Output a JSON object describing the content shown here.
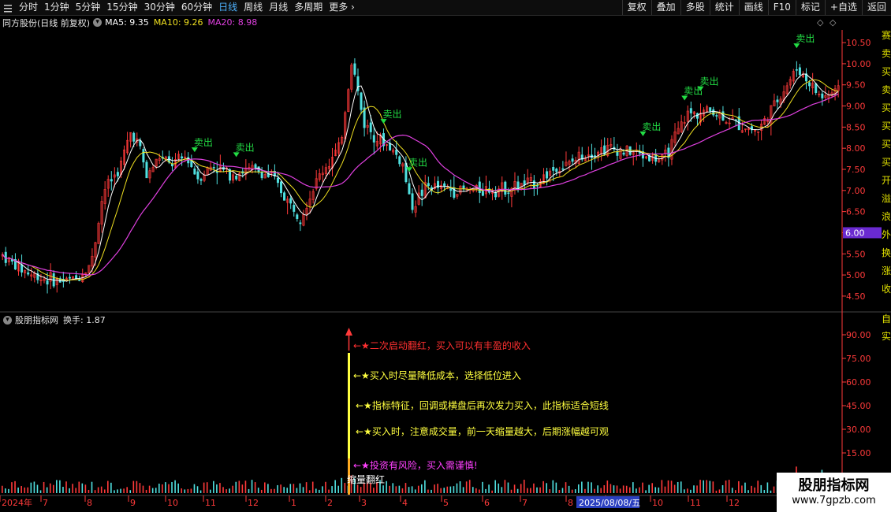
{
  "toolbar": {
    "periods": [
      "分时",
      "1分钟",
      "5分钟",
      "15分钟",
      "30分钟",
      "60分钟",
      "日线",
      "周线",
      "月线",
      "多周期",
      "更多"
    ],
    "active_period": "日线",
    "right_buttons": [
      "复权",
      "叠加",
      "多股",
      "统计",
      "画线",
      "F10",
      "标记",
      "+自选",
      "返回"
    ]
  },
  "main_header": {
    "stock": "同方股份(日线 前复权)",
    "ma5": "MA5: 9.35",
    "ma10": "MA10: 9.26",
    "ma20": "MA20: 8.98"
  },
  "colors": {
    "up": "#ff3a3a",
    "down": "#50e0e0",
    "ma5": "#ffffff",
    "ma10": "#f0e020",
    "ma20": "#e040e0",
    "signal": "#22dd44",
    "axis": "#ff3a3a",
    "price_tag": "#6a2ad0"
  },
  "price_axis": {
    "labels": [
      "10.50",
      "10.00",
      "9.50",
      "9.00",
      "8.50",
      "8.00",
      "7.50",
      "7.00",
      "6.50",
      "6.00",
      "5.50",
      "5.00",
      "4.50"
    ],
    "current_price_tag": "6.00"
  },
  "signals": [
    {
      "label": "卖出",
      "x_index": 60
    },
    {
      "label": "卖出",
      "x_index": 73
    },
    {
      "label": "卖出",
      "x_index": 119
    },
    {
      "label": "卖出",
      "x_index": 127
    },
    {
      "label": "卖出",
      "x_index": 200
    },
    {
      "label": "卖出",
      "x_index": 213
    },
    {
      "label": "卖出",
      "x_index": 218
    },
    {
      "label": "卖出",
      "x_index": 248
    }
  ],
  "indicator_header": {
    "name": "股朋指标网",
    "turnover": "换手: 1.87"
  },
  "indicator_axis": {
    "labels": [
      "90.00",
      "75.00",
      "60.00",
      "45.00",
      "30.00",
      "15.00"
    ]
  },
  "annotations": [
    {
      "text": "←★二次启动翻红，买入可以有丰盈的收入",
      "color": "#ff3030"
    },
    {
      "text": "←★买入时尽量降低成本，选择低位进入",
      "color": "#ffff40"
    },
    {
      "text": "←★指标特征，回调或横盘后再次发力买入，此指标适合短线",
      "color": "#ffff40"
    },
    {
      "text": "←★买入时，注意成交量，前一天缩量越大，后期涨幅越可观",
      "color": "#ffff40"
    },
    {
      "text": "←★投资有风险，买入需谨慎!",
      "color": "#ff40ff"
    }
  ],
  "bottom_label": "缩量翻红",
  "date_axis": {
    "labels": [
      "2024年",
      "7",
      "8",
      "9",
      "10",
      "11",
      "12",
      "1",
      "2",
      "3",
      "4",
      "5",
      "6",
      "7",
      "8",
      "9",
      "10",
      "11",
      "12"
    ],
    "cursor_date": "2025/08/08/五"
  },
  "watermark": {
    "title": "股朋指标网",
    "url": "www.7gpzb.com"
  },
  "right_edge": {
    "top_chars": [
      "赛",
      "卖",
      "买",
      "卖",
      "买",
      "买",
      "买",
      "买",
      "开",
      "溢",
      "浪",
      "外",
      "换",
      "涨",
      "收"
    ],
    "bottom_chars": [
      "自",
      "实"
    ]
  }
}
